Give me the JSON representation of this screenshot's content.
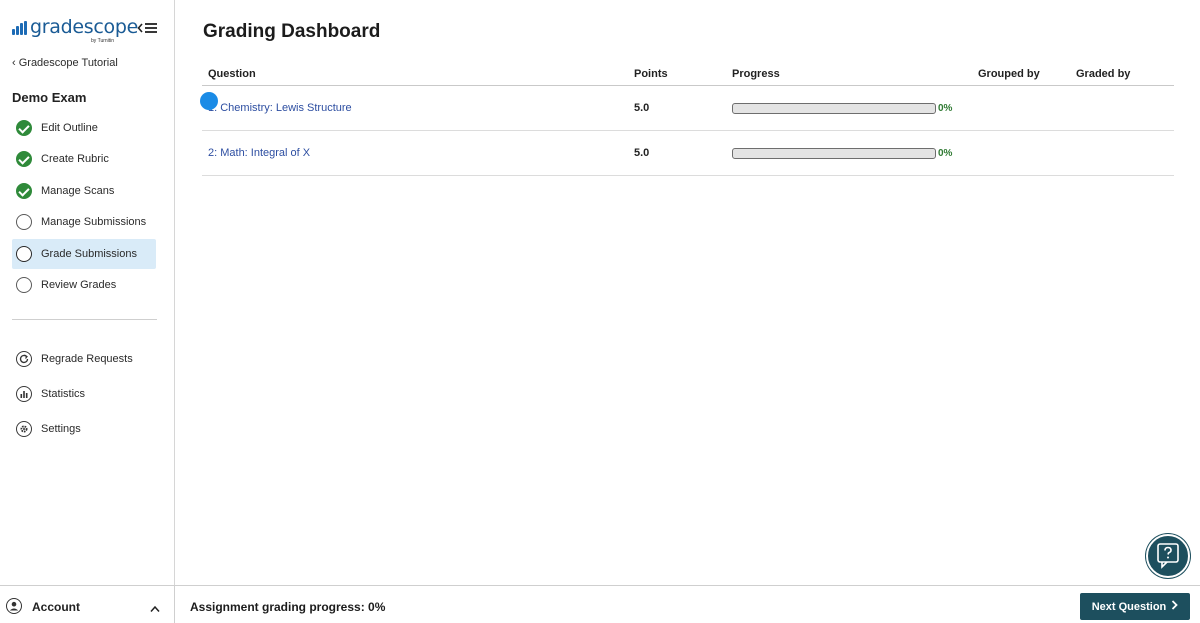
{
  "brand": {
    "name": "gradescope",
    "sub": "by Turnitin",
    "accent": "#1a5b95"
  },
  "sidebar": {
    "back_label": "‹ Gradescope Tutorial",
    "course_title": "Demo Exam",
    "steps": [
      {
        "label": "Edit Outline",
        "status": "done",
        "icon": "check-circle-icon"
      },
      {
        "label": "Create Rubric",
        "status": "done",
        "icon": "check-circle-icon"
      },
      {
        "label": "Manage Scans",
        "status": "done",
        "icon": "check-circle-icon"
      },
      {
        "label": "Manage Submissions",
        "status": "todo",
        "icon": "empty-circle-icon"
      },
      {
        "label": "Grade Submissions",
        "status": "active",
        "icon": "empty-circle-icon"
      },
      {
        "label": "Review Grades",
        "status": "todo",
        "icon": "empty-circle-icon"
      }
    ],
    "tools": [
      {
        "label": "Regrade Requests",
        "icon": "regrade-icon"
      },
      {
        "label": "Statistics",
        "icon": "statistics-icon"
      },
      {
        "label": "Settings",
        "icon": "gear-icon"
      }
    ]
  },
  "main": {
    "title": "Grading Dashboard",
    "columns": {
      "question": "Question",
      "points": "Points",
      "progress": "Progress",
      "grouped_by": "Grouped by",
      "graded_by": "Graded by"
    },
    "rows": [
      {
        "question": "1: Chemistry: Lewis Structure",
        "points": "5.0",
        "progress": 0,
        "progress_label": "0%"
      },
      {
        "question": "2: Math: Integral of X",
        "points": "5.0",
        "progress": 0,
        "progress_label": "0%"
      }
    ]
  },
  "footer": {
    "account_label": "Account",
    "progress_summary": "Assignment grading progress: 0%",
    "next_label": "Next Question"
  },
  "colors": {
    "primary": "#1d4f5e",
    "success": "#2f8a3a",
    "link": "#2d4ea1",
    "active_bg": "#d9ebf8"
  }
}
